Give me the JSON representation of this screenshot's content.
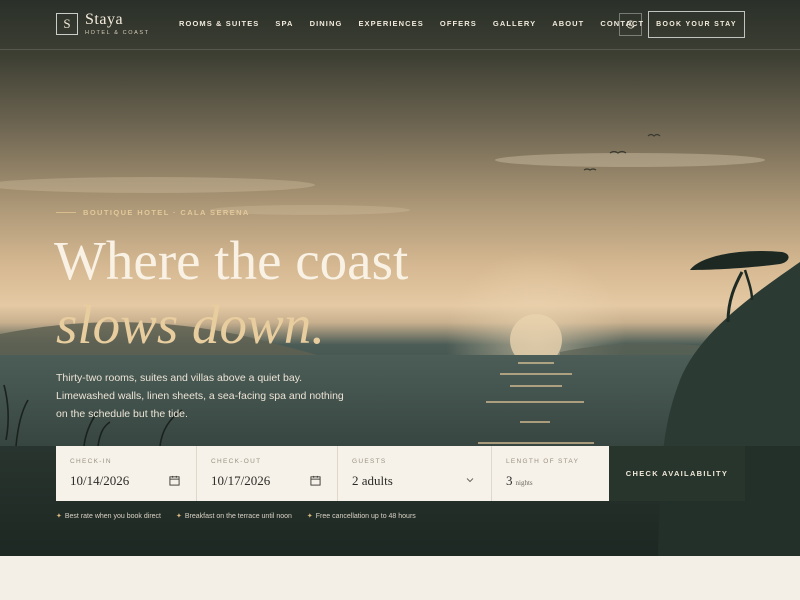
{
  "brand": {
    "mark": "S",
    "name": "Staya",
    "tagline": "HOTEL & COAST"
  },
  "nav": {
    "links": [
      "ROOMS & SUITES",
      "SPA",
      "DINING",
      "EXPERIENCES",
      "OFFERS",
      "GALLERY",
      "ABOUT",
      "CONTACT"
    ],
    "theme_toggle_icon": "moon-icon",
    "book_label": "BOOK YOUR STAY"
  },
  "hero": {
    "eyebrow": "BOUTIQUE HOTEL · CALA SERENA",
    "title_line1": "Where the coast",
    "title_line2": "slows down.",
    "lede": "Thirty-two rooms, suites and villas above a quiet bay. Limewashed walls, linen sheets, a sea-facing spa and nothing on the schedule but the tide."
  },
  "booking": {
    "checkin": {
      "label": "CHECK-IN",
      "value": "10/14/2026",
      "icon": "calendar-icon"
    },
    "checkout": {
      "label": "CHECK-OUT",
      "value": "10/17/2026",
      "icon": "calendar-icon"
    },
    "guests": {
      "label": "GUESTS",
      "value": "2 adults",
      "icon": "chevron-down-icon"
    },
    "length": {
      "label": "LENGTH OF STAY",
      "value": "3",
      "unit": "nights"
    },
    "submit_label": "CHECK AVAILABILITY"
  },
  "perks": [
    "Best rate when you book direct",
    "Breakfast on the terrace until noon",
    "Free cancellation up to 48 hours"
  ],
  "colors": {
    "accent": "#e8cd9f",
    "button_dark": "#28352c",
    "panel": "#f6f2ea"
  }
}
